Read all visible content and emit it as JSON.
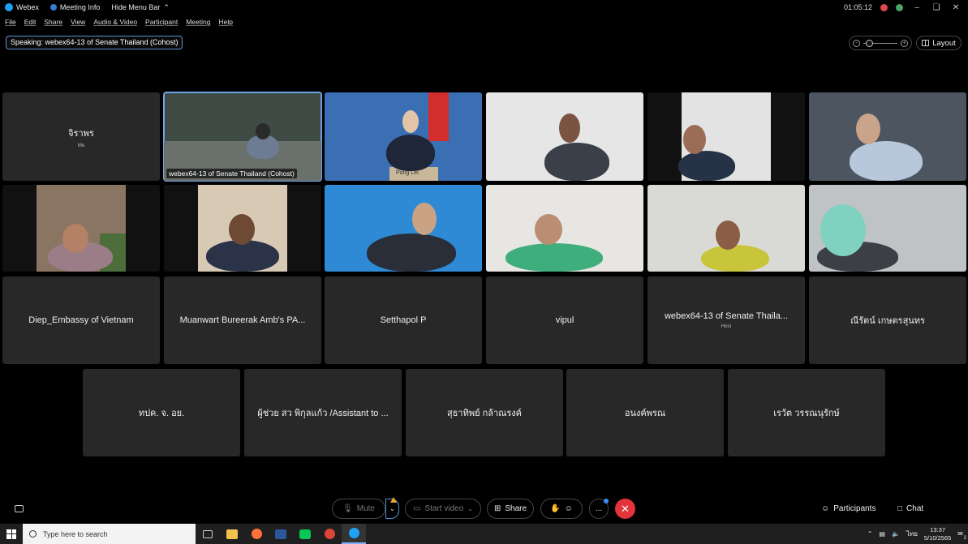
{
  "titlebar": {
    "app_name": "Webex",
    "meeting_info": "Meeting Info",
    "hide_menu": "Hide Menu Bar",
    "timer": "01:05:12",
    "rec_letter": "เ",
    "user_initial": "จ"
  },
  "menu": [
    "File",
    "Edit",
    "Share",
    "View",
    "Audio & Video",
    "Participant",
    "Meeting",
    "Help"
  ],
  "speaking": "Speaking: webex64-13 of  Senate Thailand (Cohost)",
  "layout_label": "Layout",
  "tiles": {
    "t1": {
      "name": "จิราพร",
      "sub": "Me"
    },
    "t2": {
      "label": "webex64-13 of  Senate Thailand (Cohost)"
    },
    "t3": {
      "nameplate": "Pong  Lei"
    },
    "t13": {
      "name": "Diep_Embassy of Vietnam"
    },
    "t14": {
      "name": "Muanwart Bureerak Amb's PA..."
    },
    "t15": {
      "name": "Setthapol P"
    },
    "t16": {
      "name": "vipul"
    },
    "t17": {
      "name": "webex64-13 of  Senate Thaila...",
      "sub": "Host"
    },
    "t18": {
      "name": "ณีรัตน์ เกษตรสุนทร"
    },
    "t19": {
      "name": "ทปค. จ. อย."
    },
    "t20": {
      "name": "ผู้ช่วย สว พิกุลแก้ว /Assistant to ..."
    },
    "t21": {
      "name": "สุธาทิพย์ กล้าณรงค์"
    },
    "t22": {
      "name": "อนงค์พรณ"
    },
    "t23": {
      "name": "เรวัต วรรณนุรักษ์"
    }
  },
  "controls": {
    "mute": "Mute",
    "start_video": "Start video",
    "share": "Share",
    "more": "...",
    "participants": "Participants",
    "chat": "Chat"
  },
  "taskbar": {
    "search_placeholder": "Type here to search",
    "lang": "ไทย",
    "time": "13:37",
    "date": "5/10/2565",
    "notif": "2"
  },
  "colors": {
    "accent": "#5b8fd6",
    "end_call": "#e3343c",
    "tile_bg": "#282828"
  }
}
